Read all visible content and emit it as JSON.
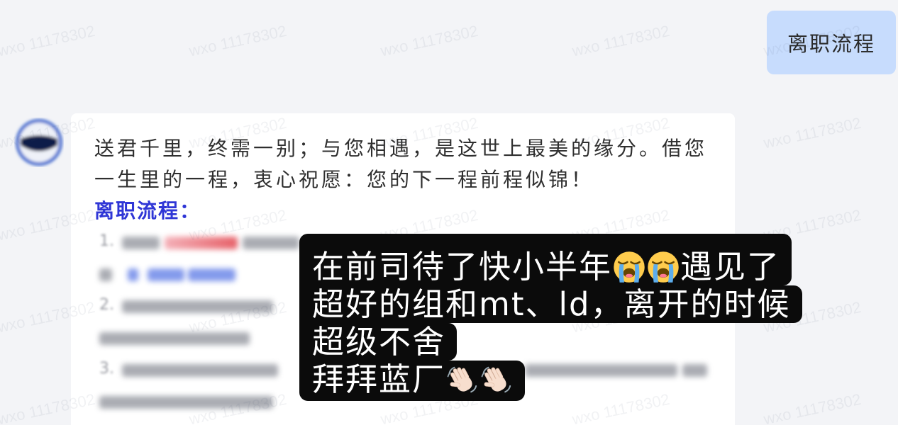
{
  "page": {
    "background": "#f3f4f7"
  },
  "watermark": {
    "text": "wxo 11178302",
    "color": "rgba(70,80,110,0.075)"
  },
  "user_message": {
    "text": "离职流程",
    "bubble_color": "#c7dcfd"
  },
  "bot_message": {
    "avatar_icon": "avatar",
    "lines": [
      "送君千里，终需一别；与您相遇，是这世上最美的缘分。借您",
      "一生里的一程，衷心祝愿：您的下一程前程似锦！"
    ],
    "section_title": "离职流程：",
    "section_title_color": "#2f36d6",
    "list_markers": [
      "1.",
      "2.",
      "3."
    ]
  },
  "caption": {
    "background": "#0b0b0b",
    "text_color": "#ffffff",
    "lines": [
      {
        "text_before": "在前司待了快小半年",
        "icons": [
          "loudly-crying-face-icon",
          "loudly-crying-face-icon"
        ],
        "text_after": "遇见了"
      },
      {
        "text_before": "超好的组和mt、ld，离开的时候"
      },
      {
        "text_before": "超级不舍"
      },
      {
        "text_before": "拜拜蓝厂",
        "icons": [
          "waving-hand-icon",
          "waving-hand-icon"
        ]
      }
    ]
  }
}
